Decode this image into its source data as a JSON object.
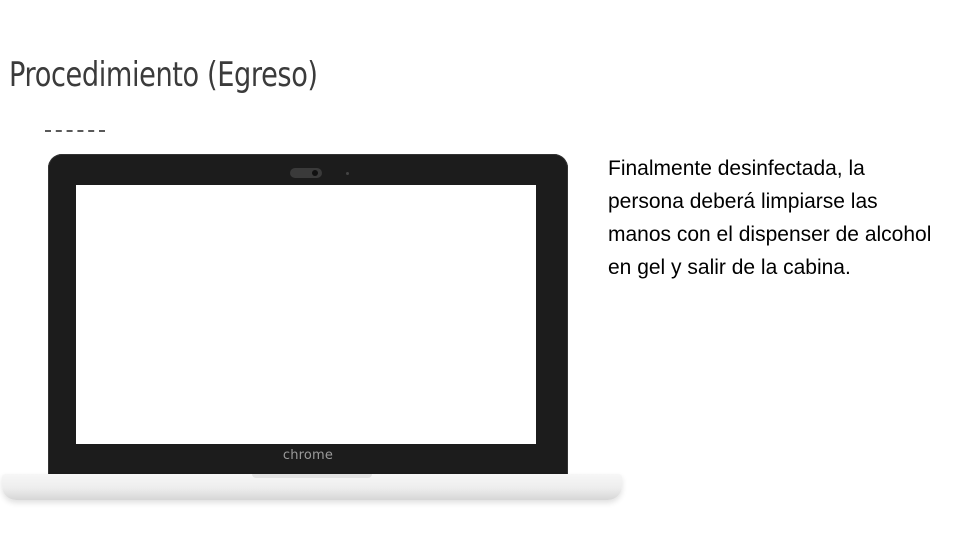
{
  "slide": {
    "title": "Procedimiento (Egreso)",
    "body": "Finalmente desinfectada, la persona deberá limpiarse las manos con el dispenser de alcohol en gel y salir de la cabina."
  },
  "image": {
    "device": "laptop",
    "brand_label": "chrome"
  },
  "colors": {
    "background": "#ffffff",
    "title": "#3b3b3b",
    "body": "#000000",
    "bezel": "#1c1c1c",
    "base": "#eeeeee"
  }
}
